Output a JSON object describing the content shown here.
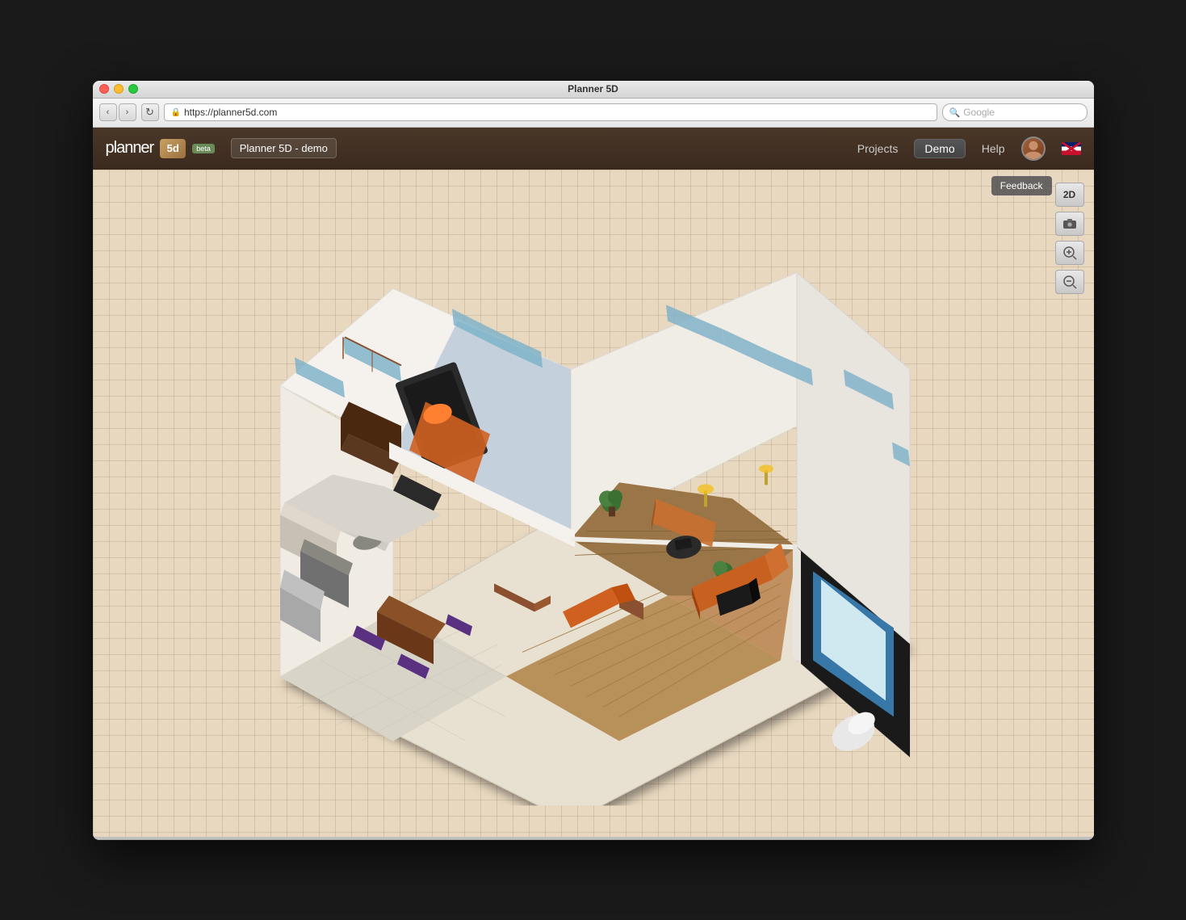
{
  "window": {
    "title": "Planner 5D",
    "url": "https://planner5d.com",
    "search_placeholder": "Google"
  },
  "header": {
    "logo_text": "planner",
    "logo_number": "5d",
    "beta_label": "beta",
    "project_name": "Planner 5D - demo",
    "nav_items": [
      {
        "label": "Projects",
        "active": false
      },
      {
        "label": "Demo",
        "active": true
      },
      {
        "label": "Help",
        "active": false
      }
    ]
  },
  "viewer": {
    "feedback_label": "Feedback",
    "toolbar_2d": "2D",
    "toolbar_camera": "📷",
    "toolbar_zoom_in": "🔍+",
    "toolbar_zoom_out": "🔍-"
  }
}
